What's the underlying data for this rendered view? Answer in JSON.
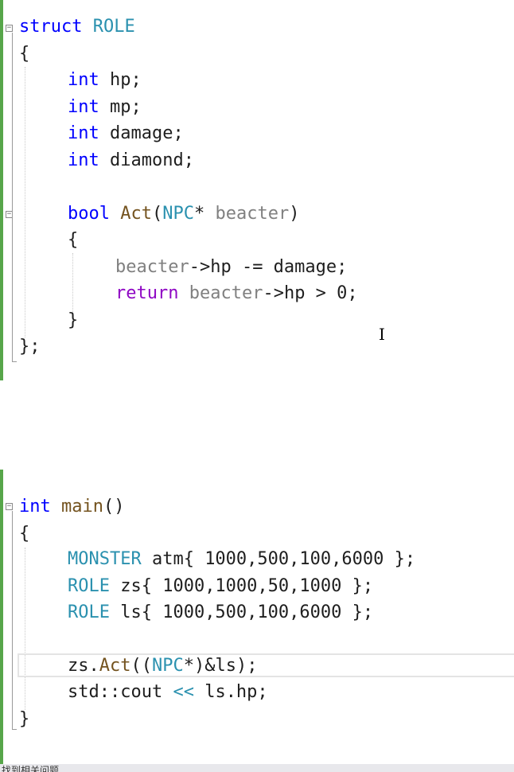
{
  "editor": {
    "lines": [
      {
        "name": "line-struct-role",
        "segments": [
          {
            "t": "struct",
            "c": "kw"
          },
          {
            "t": " "
          },
          {
            "t": "ROLE",
            "c": "type"
          }
        ]
      },
      {
        "name": "line-open-brace-1",
        "segments": [
          {
            "t": "{"
          }
        ]
      },
      {
        "name": "line-int-hp",
        "segments": [
          {
            "t": "int",
            "c": "kw"
          },
          {
            "t": " hp;"
          }
        ]
      },
      {
        "name": "line-int-mp",
        "segments": [
          {
            "t": "int",
            "c": "kw"
          },
          {
            "t": " mp;"
          }
        ]
      },
      {
        "name": "line-int-damage",
        "segments": [
          {
            "t": "int",
            "c": "kw"
          },
          {
            "t": " damage;"
          }
        ]
      },
      {
        "name": "line-int-diamond",
        "segments": [
          {
            "t": "int",
            "c": "kw"
          },
          {
            "t": " diamond;"
          }
        ]
      },
      {
        "name": "line-bool-act",
        "segments": [
          {
            "t": "bool",
            "c": "kw"
          },
          {
            "t": " "
          },
          {
            "t": "Act",
            "c": "fn"
          },
          {
            "t": "("
          },
          {
            "t": "NPC",
            "c": "type"
          },
          {
            "t": "* "
          },
          {
            "t": "beacter",
            "c": "param"
          },
          {
            "t": ")"
          }
        ]
      },
      {
        "name": "line-open-brace-2",
        "segments": [
          {
            "t": "{"
          }
        ]
      },
      {
        "name": "line-beacter-hp",
        "segments": [
          {
            "t": "beacter",
            "c": "param"
          },
          {
            "t": "->hp -= damage;"
          }
        ]
      },
      {
        "name": "line-return",
        "segments": [
          {
            "t": "return",
            "c": "kw-ret"
          },
          {
            "t": " "
          },
          {
            "t": "beacter",
            "c": "param"
          },
          {
            "t": "->hp > 0;"
          }
        ]
      },
      {
        "name": "line-close-brace-2",
        "segments": [
          {
            "t": "}"
          }
        ]
      },
      {
        "name": "line-close-struct",
        "segments": [
          {
            "t": "};"
          }
        ]
      },
      {
        "name": "line-int-main",
        "segments": [
          {
            "t": "int",
            "c": "kw"
          },
          {
            "t": " "
          },
          {
            "t": "main",
            "c": "fn"
          },
          {
            "t": "()"
          }
        ]
      },
      {
        "name": "line-open-brace-3",
        "segments": [
          {
            "t": "{"
          }
        ]
      },
      {
        "name": "line-monster-atm",
        "segments": [
          {
            "t": "MONSTER",
            "c": "type"
          },
          {
            "t": " atm{ 1000,500,100,6000 };"
          }
        ]
      },
      {
        "name": "line-role-zs",
        "segments": [
          {
            "t": "ROLE",
            "c": "type"
          },
          {
            "t": " zs{ 1000,1000,50,1000 };"
          }
        ]
      },
      {
        "name": "line-role-ls",
        "segments": [
          {
            "t": "ROLE",
            "c": "type"
          },
          {
            "t": " ls{ 1000,500,100,6000 };"
          }
        ]
      },
      {
        "name": "line-zs-act",
        "segments": [
          {
            "t": "zs."
          },
          {
            "t": "Act",
            "c": "fn"
          },
          {
            "t": "(("
          },
          {
            "t": "NPC",
            "c": "type"
          },
          {
            "t": "*)&ls);"
          }
        ]
      },
      {
        "name": "line-cout",
        "segments": [
          {
            "t": "std::cout "
          },
          {
            "t": "<<",
            "c": "type"
          },
          {
            "t": " ls.hp;"
          }
        ]
      },
      {
        "name": "line-close-brace-3",
        "segments": [
          {
            "t": "}"
          }
        ]
      }
    ],
    "fold_toggle_glyph": "−"
  },
  "cursor": {
    "glyph": "I"
  },
  "bottom_panel": {
    "text": "找到相关问题"
  },
  "colors": {
    "keyword": "#0000ff",
    "return_keyword": "#8f08c4",
    "type": "#2b91af",
    "function": "#74531f",
    "parameter": "#808080",
    "change_bar": "#57a64a"
  }
}
